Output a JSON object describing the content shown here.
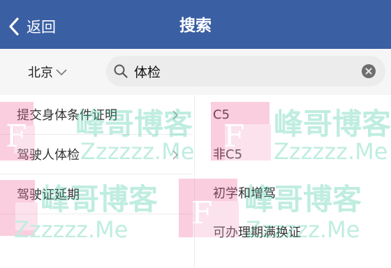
{
  "header": {
    "back_label": "返回",
    "title": "搜索",
    "background_color": "#3a5fa3"
  },
  "search_bar": {
    "city": "北京",
    "query": "体检",
    "icons": [
      "search-icon",
      "clear-icon",
      "chevron-down-icon"
    ]
  },
  "results": {
    "left_items": [
      {
        "label": "提交身体条件证明",
        "has_arrow": true
      },
      {
        "label": "驾驶人体检",
        "has_arrow": true
      },
      {
        "label": "驾驶证延期",
        "has_arrow": false
      }
    ],
    "right_items": [
      {
        "label": "C5"
      },
      {
        "label": "非C5"
      },
      {
        "label": "初学和增驾"
      },
      {
        "label": "可办理期满换证"
      }
    ]
  },
  "watermark": {
    "logo_letter": "F",
    "brand": "峰哥博客",
    "domain": "Zzzzzz.Me"
  }
}
